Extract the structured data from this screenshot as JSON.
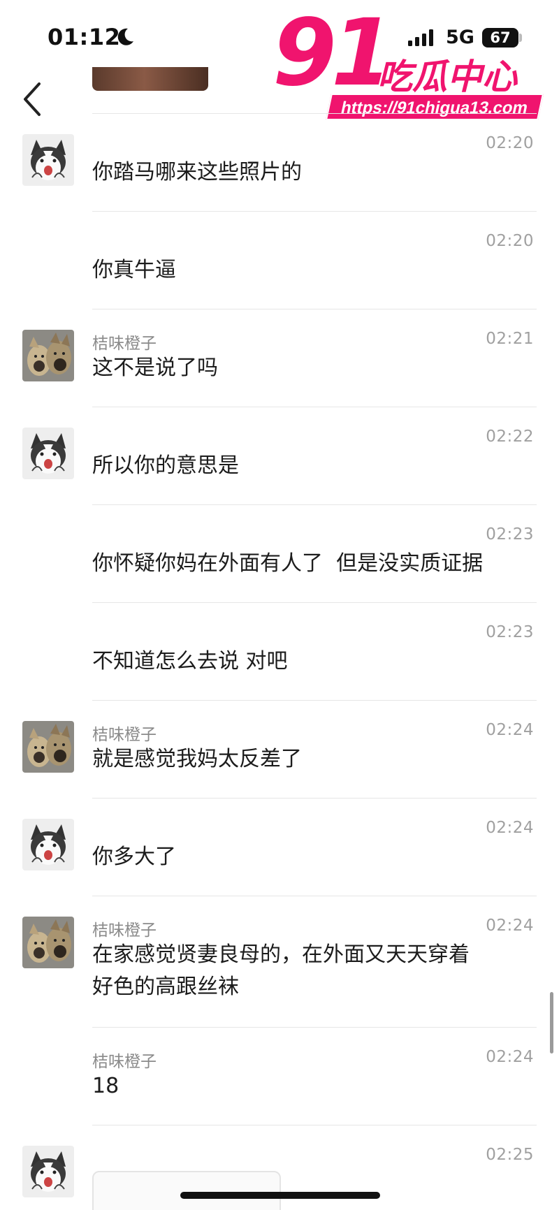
{
  "status_bar": {
    "time": "01:12",
    "network": "5G",
    "battery": "67"
  },
  "watermark": {
    "number": "91",
    "name": "吃瓜中心",
    "url": "https://91chigua13.com"
  },
  "messages": [
    {
      "sender": "",
      "time": "02:20",
      "text": "你踏马哪来这些照片的",
      "avatar": "husky-avatar"
    },
    {
      "sender": "",
      "time": "02:20",
      "text": "你真牛逼",
      "avatar": ""
    },
    {
      "sender": "桔味橙子",
      "time": "02:21",
      "text": "这不是说了吗",
      "avatar": "dogs-avatar"
    },
    {
      "sender": "",
      "time": "02:22",
      "text": "所以你的意思是",
      "avatar": "husky-avatar"
    },
    {
      "sender": "",
      "time": "02:23",
      "text": "你怀疑你妈在外面有人了  但是没实质证据",
      "avatar": ""
    },
    {
      "sender": "",
      "time": "02:23",
      "text": "不知道怎么去说 对吧",
      "avatar": ""
    },
    {
      "sender": "桔味橙子",
      "time": "02:24",
      "text": "就是感觉我妈太反差了",
      "avatar": "dogs-avatar"
    },
    {
      "sender": "",
      "time": "02:24",
      "text": "你多大了",
      "avatar": "husky-avatar"
    },
    {
      "sender": "桔味橙子",
      "time": "02:24",
      "text": "在家感觉贤妻良母的，在外面又天天穿着\n好色的高跟丝袜",
      "avatar": "dogs-avatar"
    },
    {
      "sender": "桔味橙子",
      "time": "02:24",
      "text": "18",
      "avatar": ""
    },
    {
      "sender": "",
      "time": "02:25",
      "text": "",
      "avatar": "husky-avatar"
    }
  ]
}
